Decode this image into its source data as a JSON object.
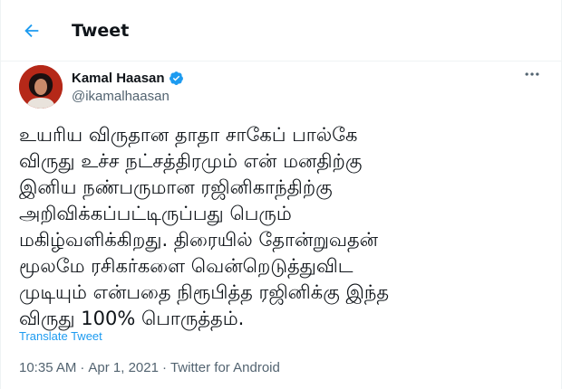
{
  "header": {
    "title": "Tweet",
    "back_icon": "arrow-left-icon"
  },
  "author": {
    "name": "Kamal Haasan",
    "handle": "@ikamalhaasan",
    "verified_icon": "verified-badge-icon",
    "avatar": "avatar",
    "more_icon": "more-options-icon"
  },
  "tweet": {
    "text": "உயரிய விருதான தாதா சாகேப் பால்கே\nவிருது உச்ச நட்சத்திரமும் என் மனதிற்கு\nஇனிய நண்பருமான ரஜினிகாந்திற்கு\nஅறிவிக்கப்பட்டிருப்பது பெரும்\nமகிழ்வளிக்கிறது. திரையில் தோன்றுவதன்\nமூலமே ரசிகர்களை வென்றெடுத்துவிட\nமுடியும் என்பதை நிரூபித்த ரஜினிக்கு இந்த\nவிருது 100% பொருத்தம்.",
    "translate_label": "Translate Tweet",
    "time": "10:35 AM",
    "separator1": "·",
    "date": "Apr 1, 2021",
    "separator2": "·",
    "source": "Twitter for Android"
  },
  "colors": {
    "accent": "#1d9bf0",
    "text": "#0f1419",
    "secondary": "#536471"
  }
}
